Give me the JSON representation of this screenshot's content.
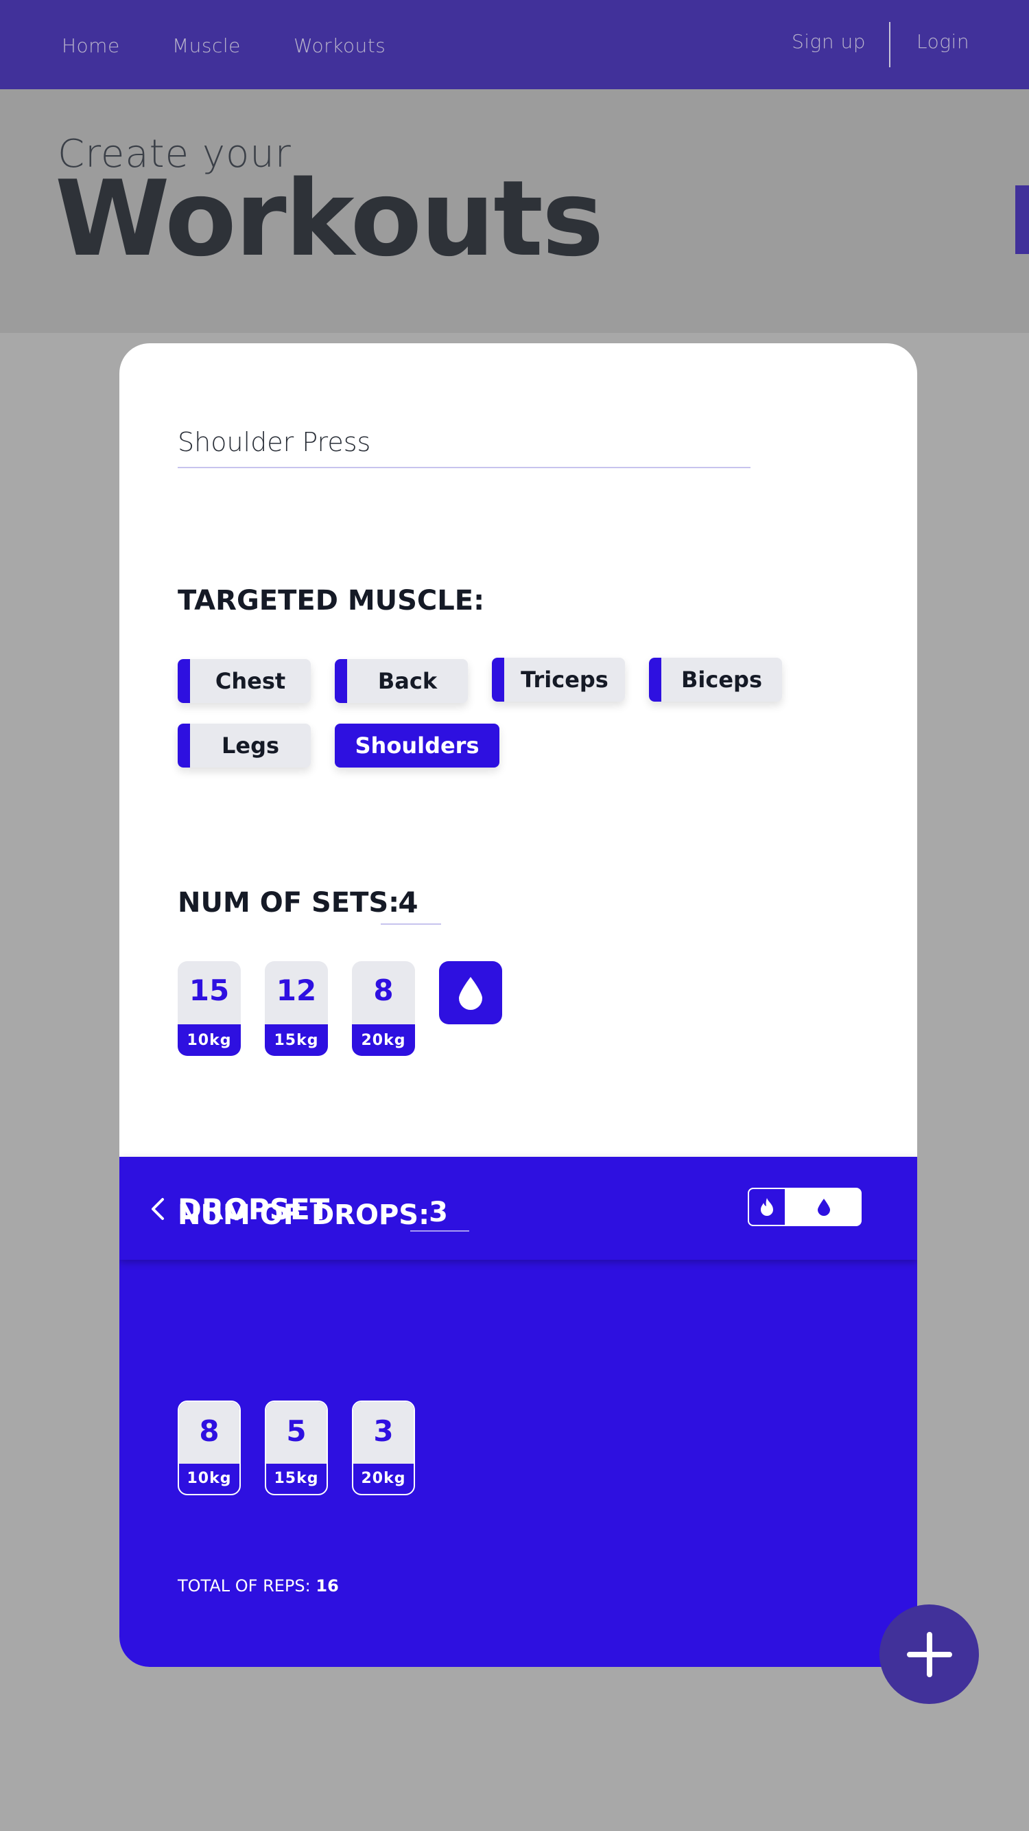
{
  "nav": {
    "home": "Home",
    "muscle": "Muscle",
    "workouts": "Workouts",
    "signup": "Sign up",
    "login": "Login"
  },
  "hero": {
    "subtitle": "Create your",
    "title": "Workouts"
  },
  "exercise": {
    "name": "Shoulder Press"
  },
  "muscle": {
    "label": "TARGETED MUSCLE:",
    "chips": [
      "Chest",
      "Back",
      "Triceps",
      "Biceps",
      "Legs",
      "Shoulders"
    ],
    "selected": "Shoulders"
  },
  "sets": {
    "label": "NUM OF SETS:",
    "count": "4",
    "items": [
      {
        "reps": "15",
        "weight": "10kg"
      },
      {
        "reps": "12",
        "weight": "15kg"
      },
      {
        "reps": "8",
        "weight": "20kg"
      }
    ],
    "dropset_icon": "drop-icon"
  },
  "dropset": {
    "title": "DROPSET",
    "toggle_icons": [
      "fire-icon",
      "drop-icon"
    ],
    "drops_label": "NUM OF DROPS:",
    "drops_count": "3",
    "drops": [
      {
        "reps": "8",
        "weight": "10kg"
      },
      {
        "reps": "5",
        "weight": "15kg"
      },
      {
        "reps": "3",
        "weight": "20kg"
      }
    ],
    "total_label": "TOTAL OF REPS:",
    "total_value": "16"
  },
  "colors": {
    "nav": "#41319a",
    "accent": "#2e10e0",
    "chip": "#e8e9ee",
    "text_dark": "#151a26"
  }
}
